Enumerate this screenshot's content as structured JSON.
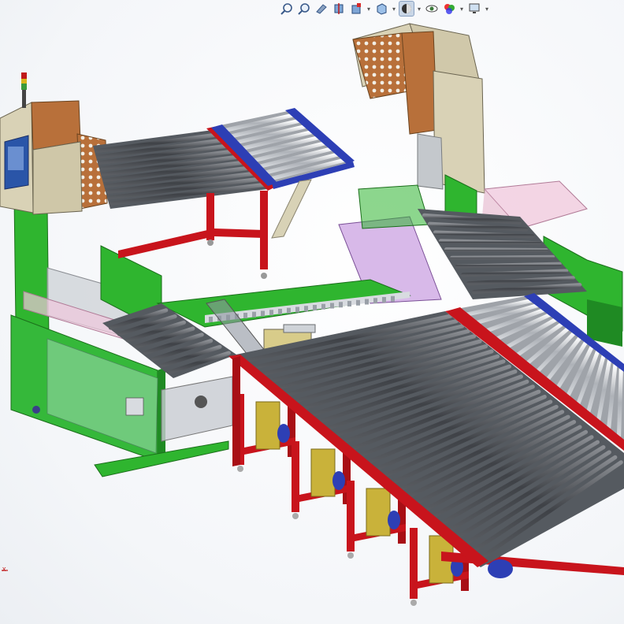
{
  "toolbar": {
    "tools": [
      {
        "id": "zoom-to-fit",
        "icon": "zoom-to-fit-icon"
      },
      {
        "id": "zoom-to-area",
        "icon": "zoom-to-area-icon"
      },
      {
        "id": "previous-view",
        "icon": "previous-view-icon"
      },
      {
        "id": "section-view",
        "icon": "section-view-icon"
      },
      {
        "id": "dynamic-annotation",
        "icon": "dynamic-annotation-icon"
      },
      {
        "id": "view-orientation",
        "icon": "view-orientation-icon"
      },
      {
        "id": "display-style",
        "icon": "display-style-icon"
      },
      {
        "id": "hide-show-items",
        "icon": "hide-show-items-icon"
      },
      {
        "id": "edit-appearance",
        "icon": "edit-appearance-icon"
      },
      {
        "id": "apply-scene",
        "icon": "apply-scene-icon"
      },
      {
        "id": "view-settings",
        "icon": "view-settings-icon"
      }
    ]
  },
  "triad": {
    "label": "x"
  },
  "colors": {
    "frame_red": "#c8141c",
    "machine_green": "#2fb52f",
    "roller_dark": "#4a4d52",
    "roller_light": "#b9bcc2",
    "guide_blue": "#2d3fb5",
    "housing_beige": "#d9d2b6",
    "housing_brown": "#b8703a",
    "leg_yellow": "#c9b23a"
  }
}
